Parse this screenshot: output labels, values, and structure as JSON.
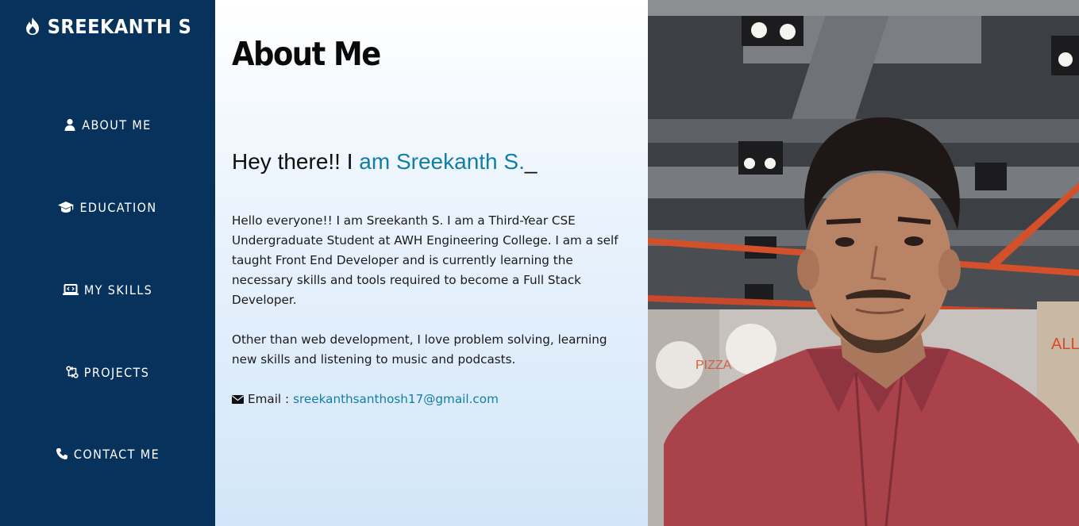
{
  "brand": {
    "name": "SREEKANTH S",
    "icon": "fire-icon"
  },
  "nav": {
    "items": [
      {
        "label": "ABOUT ME",
        "icon": "user-icon"
      },
      {
        "label": "EDUCATION",
        "icon": "graduation-cap-icon"
      },
      {
        "label": "MY SKILLS",
        "icon": "laptop-code-icon"
      },
      {
        "label": "PROJECTS",
        "icon": "project-icon"
      },
      {
        "label": "CONTACT ME",
        "icon": "phone-icon"
      }
    ]
  },
  "main": {
    "title": "About Me",
    "greeting_prefix": "Hey there!! I ",
    "greeting_name": "am Sreekanth S.",
    "greeting_cursor": "_",
    "bio_paragraph_1": "Hello everyone!! I am Sreekanth S. I am a Third-Year CSE Undergraduate Student at AWH Engineering College. I am a self taught Front End Developer and is currently learning the necessary skills and tools required to become a Full Stack Developer.",
    "bio_paragraph_2": "Other than web development, I love problem solving, learning new skills and listening to music and podcasts.",
    "email_label": "Email :",
    "email_value": "sreekanthsanthosh17@gmail.com",
    "email_icon": "envelope-icon"
  },
  "photo": {
    "wall_text": "ALL YOU NEED",
    "sign_text": "PIZZA"
  },
  "colors": {
    "sidebar_bg": "#07325c",
    "accent": "#127ea6",
    "text": "#1a1a1a"
  }
}
